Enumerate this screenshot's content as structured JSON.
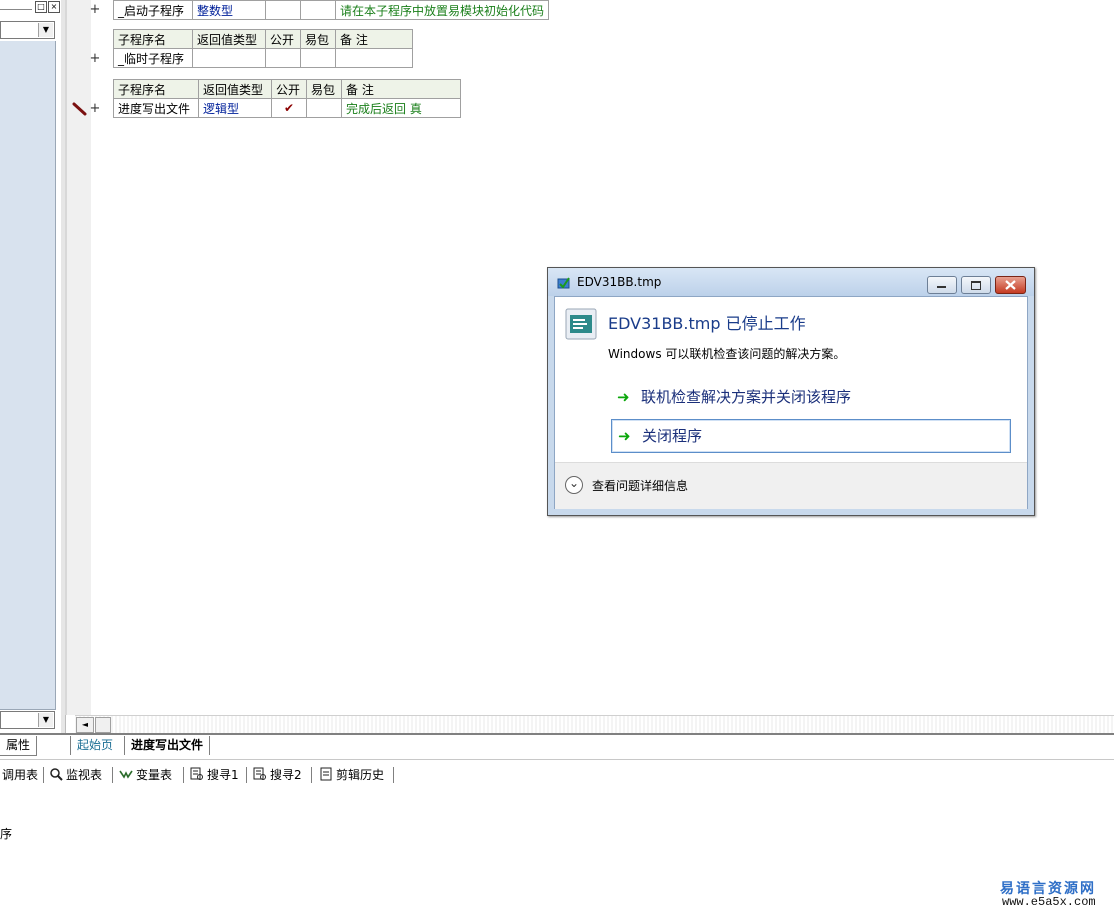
{
  "left_panel": {
    "props_tab_label": "属性",
    "min_button": "□",
    "close_button": "×",
    "combo_arrow": "▼"
  },
  "editor": {
    "table1": {
      "row": {
        "name": "_启动子程序",
        "return_type": "整数型",
        "public": "",
        "pkg": "",
        "note": "请在本子程序中放置易模块初始化代码"
      }
    },
    "table2": {
      "headers": {
        "name": "子程序名",
        "return_type": "返回值类型",
        "public": "公开",
        "pkg": "易包",
        "note": "备 注"
      },
      "row": {
        "name": "_临时子程序",
        "return_type": "",
        "public": "",
        "pkg": "",
        "note": ""
      }
    },
    "table3": {
      "headers": {
        "name": "子程序名",
        "return_type": "返回值类型",
        "public": "公开",
        "pkg": "易包",
        "note": "备 注"
      },
      "row": {
        "name": "进度写出文件",
        "return_type": "逻辑型",
        "public": "✔",
        "pkg": "",
        "note": "完成后返回 真"
      }
    },
    "plus_symbol": "+",
    "scroll_left": "◄"
  },
  "doc_tabs": [
    {
      "label": "起始页"
    },
    {
      "label": "进度写出文件"
    }
  ],
  "toolbar": {
    "items": [
      {
        "label": "调用表",
        "icon": "call-table-icon"
      },
      {
        "label": "监视表",
        "icon": "magnifier-icon"
      },
      {
        "label": "变量表",
        "icon": "variables-icon"
      },
      {
        "label": "搜寻1",
        "icon": "search-doc-icon"
      },
      {
        "label": "搜寻2",
        "icon": "search-doc-icon"
      },
      {
        "label": "剪辑历史",
        "icon": "clipboard-icon"
      }
    ]
  },
  "output": {
    "text": "序"
  },
  "dialog": {
    "title": "EDV31BB.tmp",
    "heading": "EDV31BB.tmp 已停止工作",
    "message": "Windows 可以联机检查该问题的解决方案。",
    "option1": "联机检查解决方案并关闭该程序",
    "option2": "关闭程序",
    "details": "查看问题详细信息",
    "arrow": "➜",
    "expand_glyph": "⌄",
    "accent_color": "#1a2f7a"
  },
  "watermark": {
    "line1": "易语言资源网",
    "line2": "www.e5a5x.com"
  }
}
